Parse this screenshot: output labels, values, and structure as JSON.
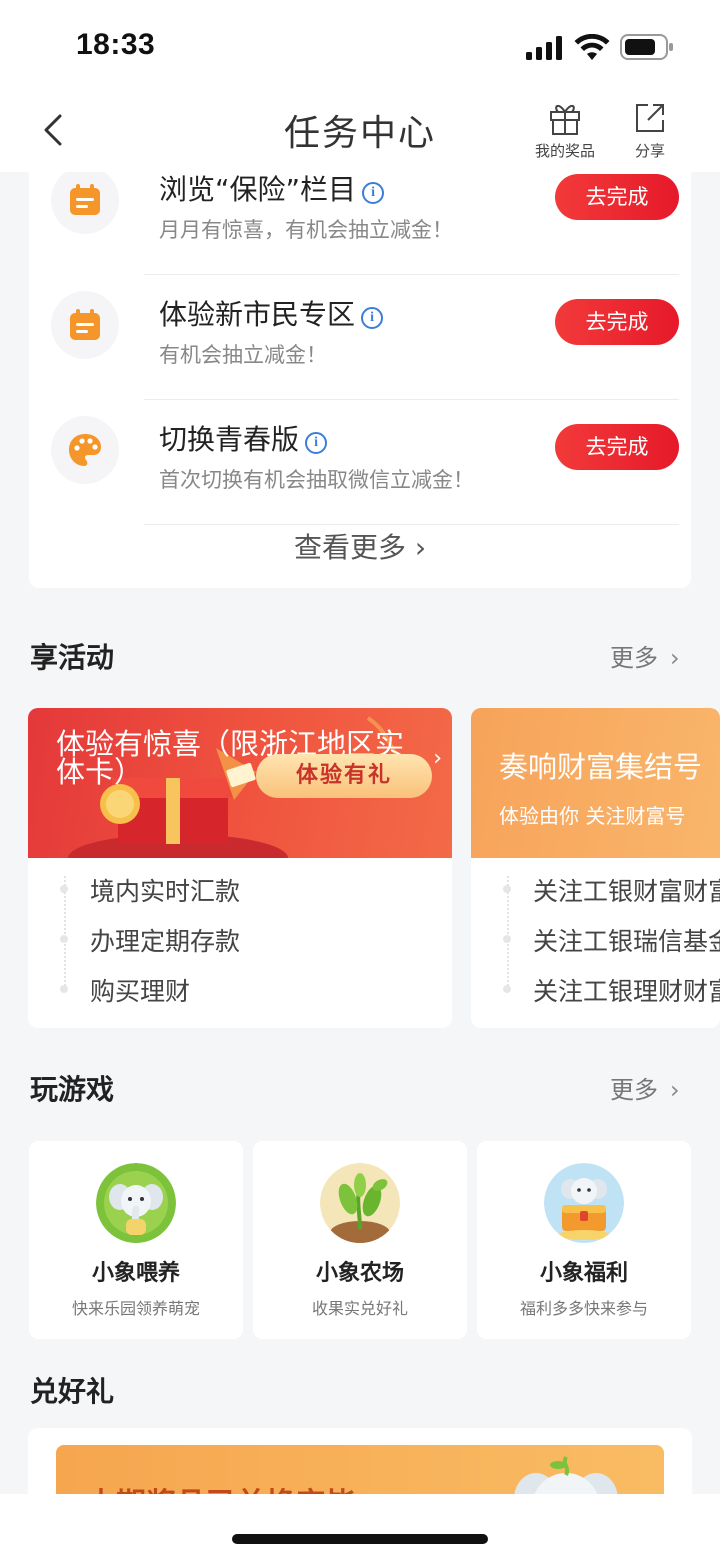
{
  "status_bar": {
    "time": "18:33"
  },
  "nav": {
    "title": "任务中心",
    "prize_label": "我的奖品",
    "share_label": "分享"
  },
  "tasks": [
    {
      "title": "浏览“保险”栏目",
      "desc": "月月有惊喜，有机会抽立减金！",
      "button": "去完成",
      "icon": "calendar-icon"
    },
    {
      "title": "体验新市民专区",
      "desc": "有机会抽立减金！",
      "button": "去完成",
      "icon": "calendar-icon"
    },
    {
      "title": "切换青春版",
      "desc": "首次切换有机会抽取微信立减金！",
      "button": "去完成",
      "icon": "palette-icon"
    }
  ],
  "tasks_more": "查看更多",
  "activities": {
    "title": "享活动",
    "more": "更多",
    "cards": [
      {
        "banner_title": "体验有惊喜（限浙江地区实体卡）",
        "banner_badge": "体验有礼",
        "items": [
          "境内实时汇款",
          "办理定期存款",
          "购买理财"
        ]
      },
      {
        "banner_title": "奏响财富集结号",
        "banner_sub": "体验由你 关注财富号",
        "items": [
          "关注工银财富财富号",
          "关注工银瑞信基金",
          "关注工银理财财富号"
        ]
      }
    ]
  },
  "games": {
    "title": "玩游戏",
    "more": "更多",
    "items": [
      {
        "name": "小象喂养",
        "desc": "快来乐园领养萌宠",
        "icon": "elephant-icon"
      },
      {
        "name": "小象农场",
        "desc": "收果实兑好礼",
        "icon": "bean-sprout-icon"
      },
      {
        "name": "小象福利",
        "desc": "福利多多快来参与",
        "icon": "elephant-treasure-icon"
      }
    ]
  },
  "redeem": {
    "title": "兑好礼",
    "banner_text": "本期奖品已兑换完毕"
  },
  "colors": {
    "accent_red": "#e6192a",
    "info_blue": "#3b7ed8",
    "task_icon_orange": "#f5962a"
  }
}
